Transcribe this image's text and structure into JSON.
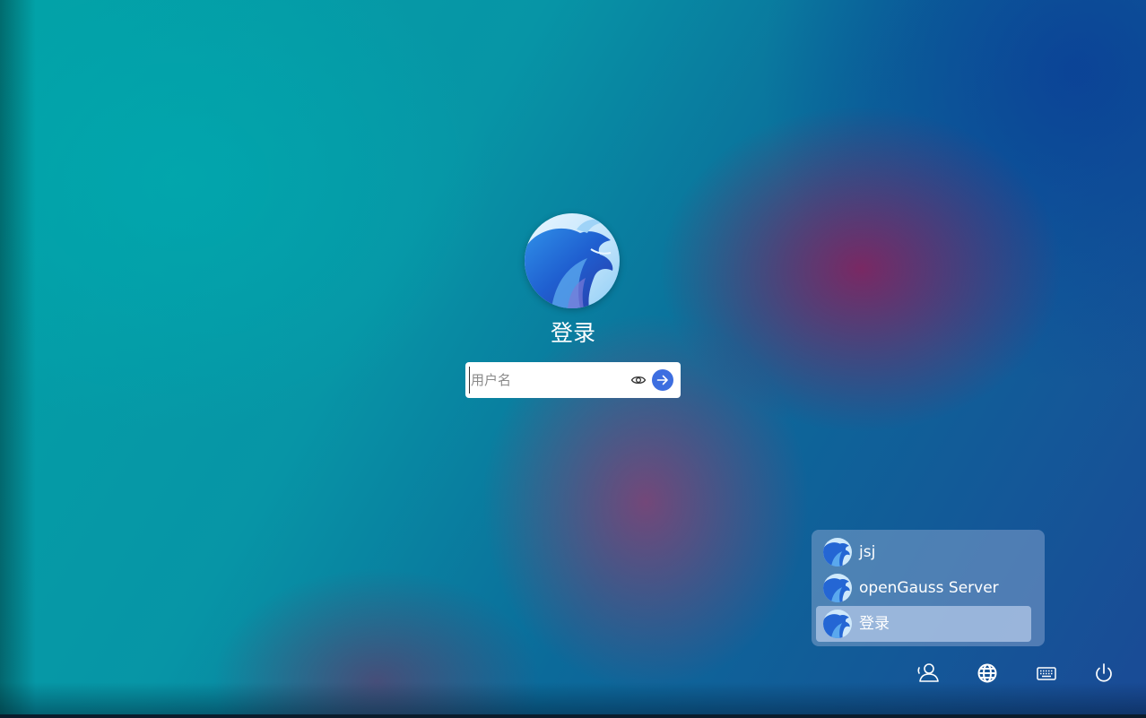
{
  "login": {
    "title": "登录",
    "username_placeholder": "用户名",
    "username_value": ""
  },
  "users": [
    {
      "name": "jsj",
      "selected": false
    },
    {
      "name": "openGauss Server",
      "selected": false
    },
    {
      "name": "登录",
      "selected": true
    }
  ],
  "tray": {
    "icons": [
      "switch-user-icon",
      "globe-icon",
      "keyboard-icon",
      "power-icon"
    ]
  },
  "colors": {
    "accent": "#3d6ee0",
    "input_bg": "#ffffff",
    "panel_bg": "rgba(150,175,215,0.45)"
  }
}
